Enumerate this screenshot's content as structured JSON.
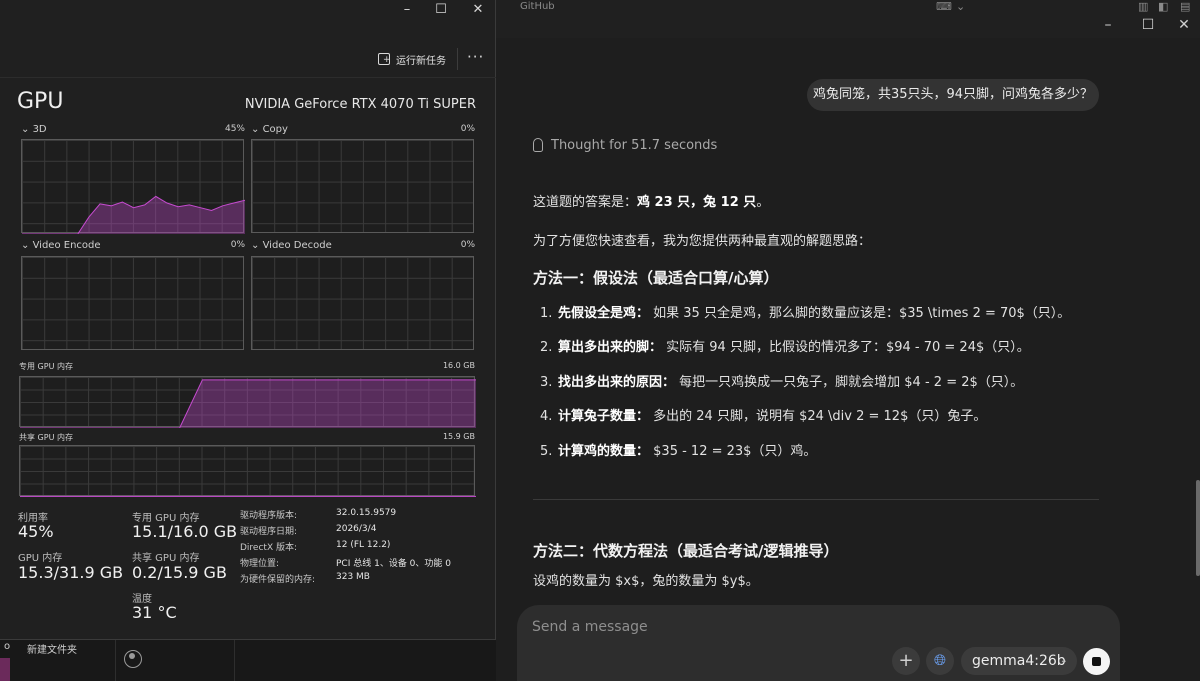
{
  "chat": {
    "tab_title": "GitHub",
    "user_message": "鸡兔同笼，共35只头，94只脚，问鸡兔各多少？",
    "thought": "Thought for 51.7 seconds",
    "answer_prefix": "这道题的答案是：",
    "answer_bold": "鸡 23 只，兔 12 只",
    "answer_suffix": "。",
    "intro": "为了方便您快速查看，我为您提供两种最直观的解题思路：",
    "method1_title": "方法一：假设法（最适合口算/心算）",
    "method1_steps": [
      {
        "num": "1.",
        "bold": "先假设全是鸡：",
        "text": "如果 35 只全是鸡，那么脚的数量应该是：$35 \\times 2 = 70$（只）。"
      },
      {
        "num": "2.",
        "bold": "算出多出来的脚：",
        "text": "实际有 94 只脚，比假设的情况多了：$94 - 70 = 24$（只）。"
      },
      {
        "num": "3.",
        "bold": "找出多出来的原因：",
        "text": "每把一只鸡换成一只兔子，脚就会增加 $4 - 2 = 2$（只）。"
      },
      {
        "num": "4.",
        "bold": "计算兔子数量：",
        "text": "多出的 24 只脚，说明有 $24 \\div 2 = 12$（只）兔子。"
      },
      {
        "num": "5.",
        "bold": "计算鸡的数量：",
        "text": "$35 - 12 = 23$（只）鸡。"
      }
    ],
    "method2_title": "方法二：代数方程法（最适合考试/逻辑推导）",
    "method2_line": "设鸡的数量为 $x$，兔的数量为 $y$。",
    "composer_placeholder": "Send a message",
    "model": "gemma4:26b"
  },
  "desktop": {
    "folder_label": "新建文件夹",
    "left_label": "o"
  },
  "taskmgr": {
    "run_task": "运行新任务",
    "title": "GPU",
    "gpu_name": "NVIDIA GeForce RTX 4070 Ti SUPER",
    "graphs": {
      "g3d_label": "3D",
      "g3d_pct": "45%",
      "copy_label": "Copy",
      "copy_pct": "0%",
      "venc_label": "Video Encode",
      "venc_pct": "0%",
      "vdec_label": "Video Decode",
      "vdec_pct": "0%",
      "ded_label": "专用 GPU 内存",
      "ded_max": "16.0 GB",
      "shared_label": "共享 GPU 内存",
      "shared_max": "15.9 GB"
    },
    "stats": {
      "util_label": "利用率",
      "util_value": "45%",
      "gpumem_label": "GPU 内存",
      "gpumem_value": "15.3/31.9 GB",
      "ded_label": "专用 GPU 内存",
      "ded_value": "15.1/16.0 GB",
      "shared_label": "共享 GPU 内存",
      "shared_value": "0.2/15.9 GB",
      "temp_label": "温度",
      "temp_value": "31 °C"
    },
    "info": [
      {
        "label": "驱动程序版本:",
        "value": "32.0.15.9579"
      },
      {
        "label": "驱动程序日期:",
        "value": "2026/3/4"
      },
      {
        "label": "DirectX 版本:",
        "value": "12 (FL 12.2)"
      },
      {
        "label": "物理位置:",
        "value": "PCI 总线 1、设备 0、功能 0"
      },
      {
        "label": "为硬件保留的内存:",
        "value": "323 MB"
      }
    ],
    "accent_color": "#c64bd0"
  },
  "chart_data": [
    {
      "type": "area",
      "title": "3D",
      "ylim": [
        0,
        100
      ],
      "x_seconds_ago": [
        60,
        57,
        54,
        51,
        48,
        45,
        42,
        39,
        36,
        33,
        30,
        27,
        24,
        21,
        18,
        15,
        12,
        9,
        6,
        3,
        0
      ],
      "values": [
        0,
        0,
        0,
        0,
        0,
        0,
        18,
        32,
        30,
        34,
        28,
        31,
        40,
        33,
        29,
        31,
        28,
        25,
        30,
        33,
        36
      ]
    },
    {
      "type": "area",
      "title": "专用 GPU 内存",
      "ylim": [
        0,
        16.0
      ],
      "values_gb": [
        0,
        0,
        0,
        0,
        0,
        0,
        0,
        0,
        15.1,
        15.1,
        15.1,
        15.1,
        15.1,
        15.1,
        15.1,
        15.1,
        15.1,
        15.1,
        15.1,
        15.1,
        15.1
      ]
    },
    {
      "type": "area",
      "title": "共享 GPU 内存",
      "ylim": [
        0,
        15.9
      ],
      "values_gb": [
        0.2
      ]
    }
  ]
}
